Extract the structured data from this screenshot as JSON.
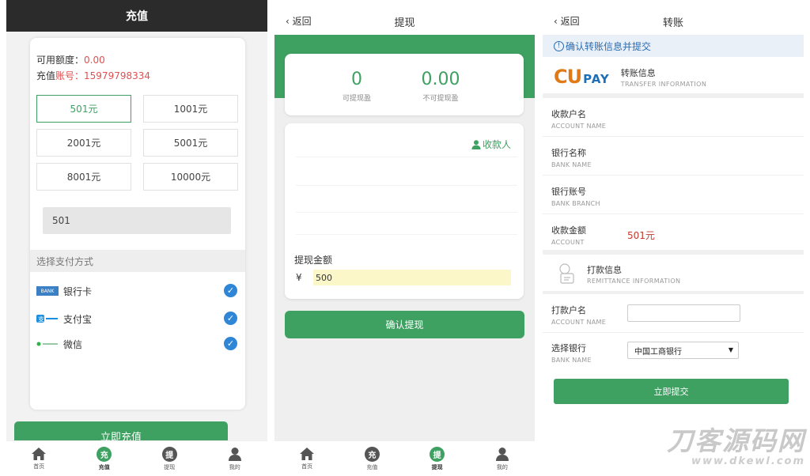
{
  "recharge": {
    "title": "充值",
    "available_label": "可用额度：",
    "available_value": "0.00",
    "account_label": "充值",
    "account_label_red": "账号：",
    "account_value": "15979798334",
    "amounts": [
      "501元",
      "1001元",
      "2001元",
      "5001元",
      "8001元",
      "10000元"
    ],
    "selected_amount_index": 0,
    "amount_input_value": "501",
    "pay_section_label": "选择支付方式",
    "pay_methods": [
      {
        "label": "银行卡",
        "icon": "bank-card-icon",
        "logo_text": "BANK",
        "checked": true
      },
      {
        "label": "支付宝",
        "icon": "alipay-icon",
        "logo_text": "",
        "checked": true
      },
      {
        "label": "微信",
        "icon": "wechat-icon",
        "logo_text": "",
        "checked": true
      }
    ],
    "submit_label": "立即充值"
  },
  "nav": {
    "items": [
      {
        "label": "首页",
        "icon": "home-icon"
      },
      {
        "label": "充值",
        "icon": "recharge-icon",
        "glyph": "充"
      },
      {
        "label": "提现",
        "icon": "withdraw-icon",
        "glyph": "提"
      },
      {
        "label": "我的",
        "icon": "user-icon"
      }
    ]
  },
  "withdraw": {
    "back_label": "返回",
    "title": "提现",
    "withdrawable_value": "0",
    "withdrawable_label": "可提现盈",
    "non_withdrawable_value": "0.00",
    "non_withdrawable_label": "不可提现盈",
    "payee_label": "收款人",
    "amount_label": "提现金额",
    "currency_symbol": "¥",
    "amount_value": "500",
    "confirm_label": "确认提现"
  },
  "transfer": {
    "back_label": "返回",
    "title": "转账",
    "notice": "确认转账信息并提交",
    "logo_cu": "CU",
    "logo_pay": "PAY",
    "section1_cn": "转账信息",
    "section1_en": "TRANSFER INFORMATION",
    "rows": [
      {
        "cn": "收款户名",
        "en": "ACCOUNT NAME",
        "value": ""
      },
      {
        "cn": "银行名称",
        "en": "BANK NAME",
        "value": ""
      },
      {
        "cn": "银行账号",
        "en": "BANK BRANCH",
        "value": ""
      },
      {
        "cn": "收款金额",
        "en": "ACCOUNT",
        "value": "501元"
      }
    ],
    "section2_cn": "打款信息",
    "section2_en": "REMITTANCE INFORMATION",
    "payer_cn": "打款户名",
    "payer_en": "ACCOUNT NAME",
    "payer_value": "",
    "bank_select_cn": "选择银行",
    "bank_select_en": "BANK NAME",
    "bank_selected": "中国工商银行",
    "submit_label": "立即提交"
  },
  "watermark": {
    "line1": "刀客源码网",
    "line2": "www.dkewl.com"
  },
  "colors": {
    "brand_green": "#3ea061",
    "header_dark": "#2b2b2b",
    "accent_red": "#e05050",
    "check_blue": "#2f86d6",
    "notice_blue": "#2b6cb0"
  }
}
